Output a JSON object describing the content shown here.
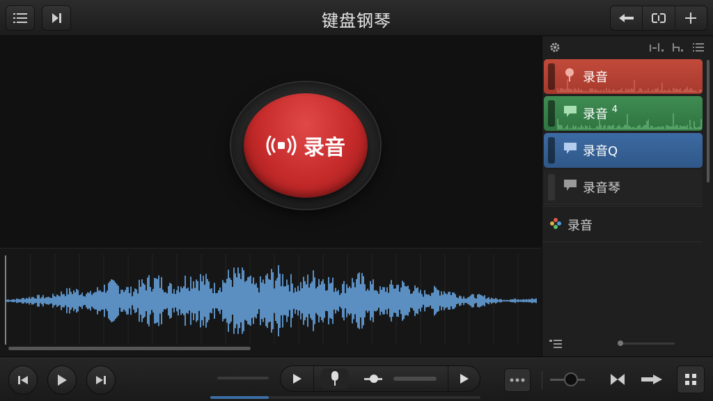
{
  "header": {
    "title": "键盘钢琴"
  },
  "stage": {
    "record_label": "录音"
  },
  "tracks": [
    {
      "label": "录音",
      "color": "#c24a3a"
    },
    {
      "label": "录音",
      "suffix": "4",
      "color": "#3f8c52"
    },
    {
      "label": "录音Q",
      "color": "#3c6aa3"
    },
    {
      "label": "录音琴",
      "color": "#3a3a3a"
    }
  ],
  "instrument": {
    "label": "录音"
  },
  "colors": {
    "accent_red": "#c52a2a",
    "wave_blue": "#5b8fc2"
  }
}
